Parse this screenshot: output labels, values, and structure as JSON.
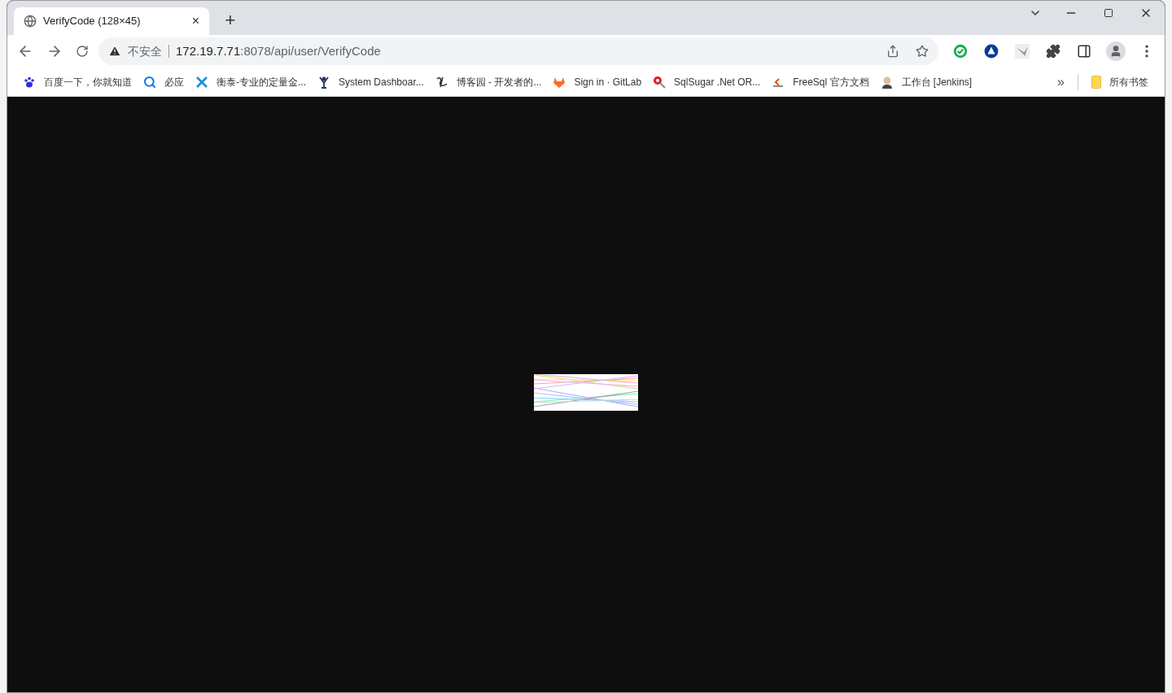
{
  "tab": {
    "title": "VerifyCode (128×45)",
    "close": "×",
    "new_tab": "+",
    "selected": true
  },
  "address": {
    "security": "不安全",
    "host": "172.19.7.71",
    "path": ":8078/api/user/VerifyCode"
  },
  "bookmarks": [
    {
      "label": "百度一下，你就知道"
    },
    {
      "label": "必应"
    },
    {
      "label": "衡泰-专业的定量金..."
    },
    {
      "label": "System Dashboar..."
    },
    {
      "label": "博客园 - 开发者的..."
    },
    {
      "label": "Sign in · GitLab"
    },
    {
      "label": "SqlSugar .Net OR..."
    },
    {
      "label": "FreeSql 官方文档"
    },
    {
      "label": "工作台 [Jenkins]"
    }
  ],
  "more": "»",
  "all_bookmarks": "所有书签"
}
